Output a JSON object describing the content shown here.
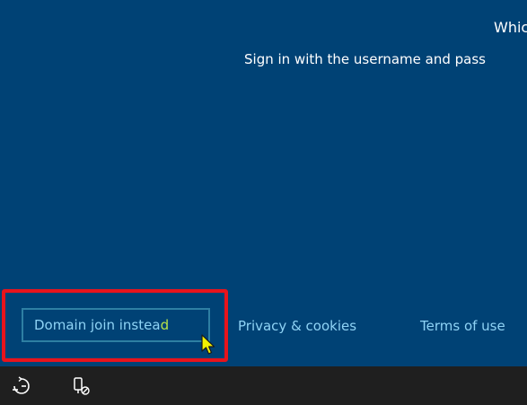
{
  "oobe": {
    "heading": "Whic",
    "subtext": "Sign in with the username and pass"
  },
  "footer": {
    "domain_join_prefix": "Domain join instea",
    "domain_join_suffix": "d",
    "privacy": "Privacy & cookies",
    "terms": "Terms of use"
  },
  "taskbar": {
    "icons": [
      "ease-of-access-icon",
      "network-icon"
    ]
  },
  "colors": {
    "background": "#004275",
    "link": "#8fd3f5",
    "highlight": "#e8141c",
    "taskbar": "#1f1f1f"
  }
}
